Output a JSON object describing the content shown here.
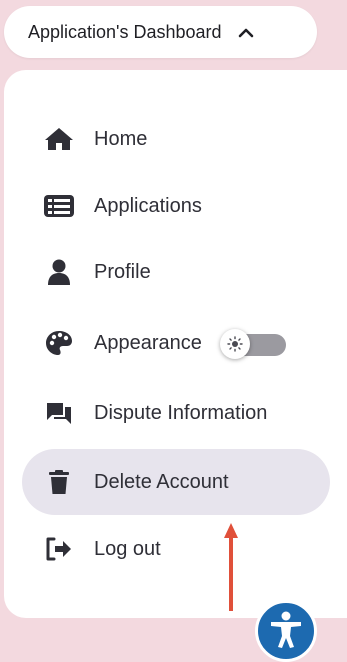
{
  "dashboard_toggle": {
    "label": "Application's Dashboard",
    "icon": "chevron-up-icon"
  },
  "nav": {
    "items": [
      {
        "label": "Home",
        "icon": "home-icon"
      },
      {
        "label": "Applications",
        "icon": "list-icon"
      },
      {
        "label": "Profile",
        "icon": "user-icon"
      },
      {
        "label": "Appearance",
        "icon": "palette-icon"
      },
      {
        "label": "Dispute Information",
        "icon": "chat-icon"
      },
      {
        "label": "Delete Account",
        "icon": "trash-icon",
        "active": true
      },
      {
        "label": "Log out",
        "icon": "logout-icon"
      }
    ],
    "appearance_toggle": {
      "state": "light",
      "icon": "sun-icon"
    }
  },
  "colors": {
    "background": "#f3d9df",
    "active_item": "#e7e4ed",
    "icon": "#2f2f37",
    "arrow": "#e0503a",
    "accessibility": "#1d6ab0"
  },
  "accessibility_button": {
    "icon": "accessibility-icon"
  }
}
